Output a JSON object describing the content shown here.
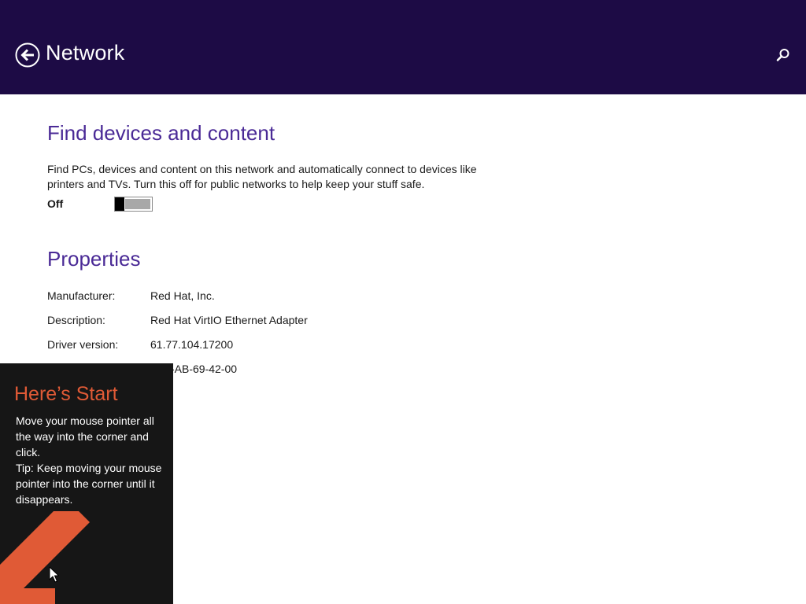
{
  "header": {
    "title": "Network",
    "back_icon": "back-arrow-circle-icon",
    "search_icon": "search-icon",
    "background": "#1d0b45"
  },
  "find_devices": {
    "title": "Find devices and content",
    "description": "Find PCs, devices and content on this network and automatically connect to devices like printers and TVs. Turn this off for public networks to help keep your stuff safe.",
    "toggle_label": "Off",
    "toggle_on": false
  },
  "properties": {
    "title": "Properties",
    "rows": [
      {
        "label": "Manufacturer:",
        "value": "Red Hat, Inc."
      },
      {
        "label": "Description:",
        "value": "Red Hat VirtIO Ethernet Adapter"
      },
      {
        "label": "Driver version:",
        "value": "61.77.104.17200"
      },
      {
        "label": "",
        "value": "-AB-69-42-00"
      }
    ]
  },
  "start_tip": {
    "title": "Here’s Start",
    "line1": "Move your mouse pointer all the way into the corner and click.",
    "line2": "Tip: Keep moving your mouse pointer into the corner until it disappears.",
    "arrow_icon": "arrow-down-left-icon",
    "accent": "#e05a36"
  },
  "colors": {
    "section_title": "#4a2a96",
    "tip_background": "#161616"
  }
}
